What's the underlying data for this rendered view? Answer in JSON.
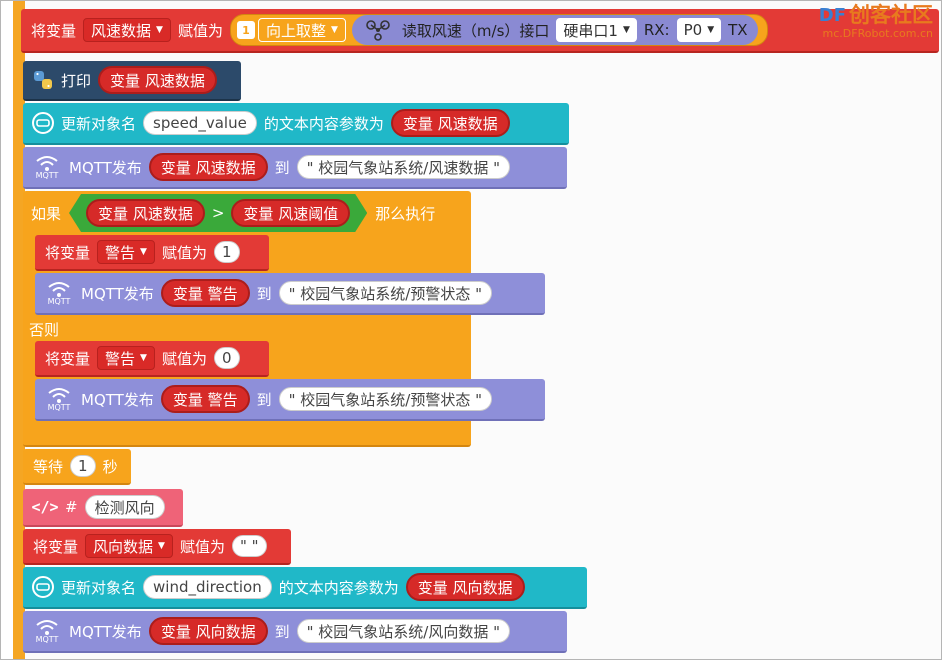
{
  "watermark": {
    "logo": "DF",
    "title": "创客社区",
    "url": "mc.DFRobot.com.cn"
  },
  "rows": {
    "assign_speed": {
      "set_label": "将变量",
      "var": "风速数据",
      "assign_label": "赋值为",
      "round_func": "向上取整",
      "read_label": "读取风速（m/s）接口",
      "port": "硬串口1",
      "rx_label": "RX:",
      "rx_pin": "P0",
      "tx_label": "TX"
    },
    "print": {
      "label": "打印",
      "var_prefix": "变量",
      "var": "风速数据"
    },
    "update_speed": {
      "label": "更新对象名",
      "object": "speed_value",
      "suffix": "的文本内容参数为",
      "var_prefix": "变量",
      "var": "风速数据"
    },
    "mqtt_speed": {
      "label": "MQTT发布",
      "var_prefix": "变量",
      "var": "风速数据",
      "to": "到",
      "topic": "\" 校园气象站系统/风速数据 \"",
      "icon_text": "MQTT"
    },
    "if_block": {
      "if_label": "如果",
      "left_prefix": "变量",
      "left_var": "风速数据",
      "op": ">",
      "right_prefix": "变量",
      "right_var": "风速阈值",
      "then_label": "那么执行",
      "else_label": "否则"
    },
    "assign_alarm_1": {
      "set_label": "将变量",
      "var": "警告",
      "assign_label": "赋值为",
      "value": "1"
    },
    "mqtt_alarm_1": {
      "label": "MQTT发布",
      "var_prefix": "变量",
      "var": "警告",
      "to": "到",
      "topic": "\" 校园气象站系统/预警状态 \"",
      "icon_text": "MQTT"
    },
    "assign_alarm_0": {
      "set_label": "将变量",
      "var": "警告",
      "assign_label": "赋值为",
      "value": "0"
    },
    "mqtt_alarm_0": {
      "label": "MQTT发布",
      "var_prefix": "变量",
      "var": "警告",
      "to": "到",
      "topic": "\" 校园气象站系统/预警状态 \"",
      "icon_text": "MQTT"
    },
    "wait": {
      "label": "等待",
      "value": "1",
      "unit": "秒"
    },
    "comment": {
      "hash": "#",
      "text": "检测风向"
    },
    "assign_dir": {
      "set_label": "将变量",
      "var": "风向数据",
      "assign_label": "赋值为",
      "value": "\" \""
    },
    "update_dir": {
      "label": "更新对象名",
      "object": "wind_direction",
      "suffix": "的文本内容参数为",
      "var_prefix": "变量",
      "var": "风向数据"
    },
    "mqtt_dir": {
      "label": "MQTT发布",
      "var_prefix": "变量",
      "var": "风向数据",
      "to": "到",
      "topic": "\" 校园气象站系统/风向数据 \"",
      "icon_text": "MQTT"
    }
  }
}
